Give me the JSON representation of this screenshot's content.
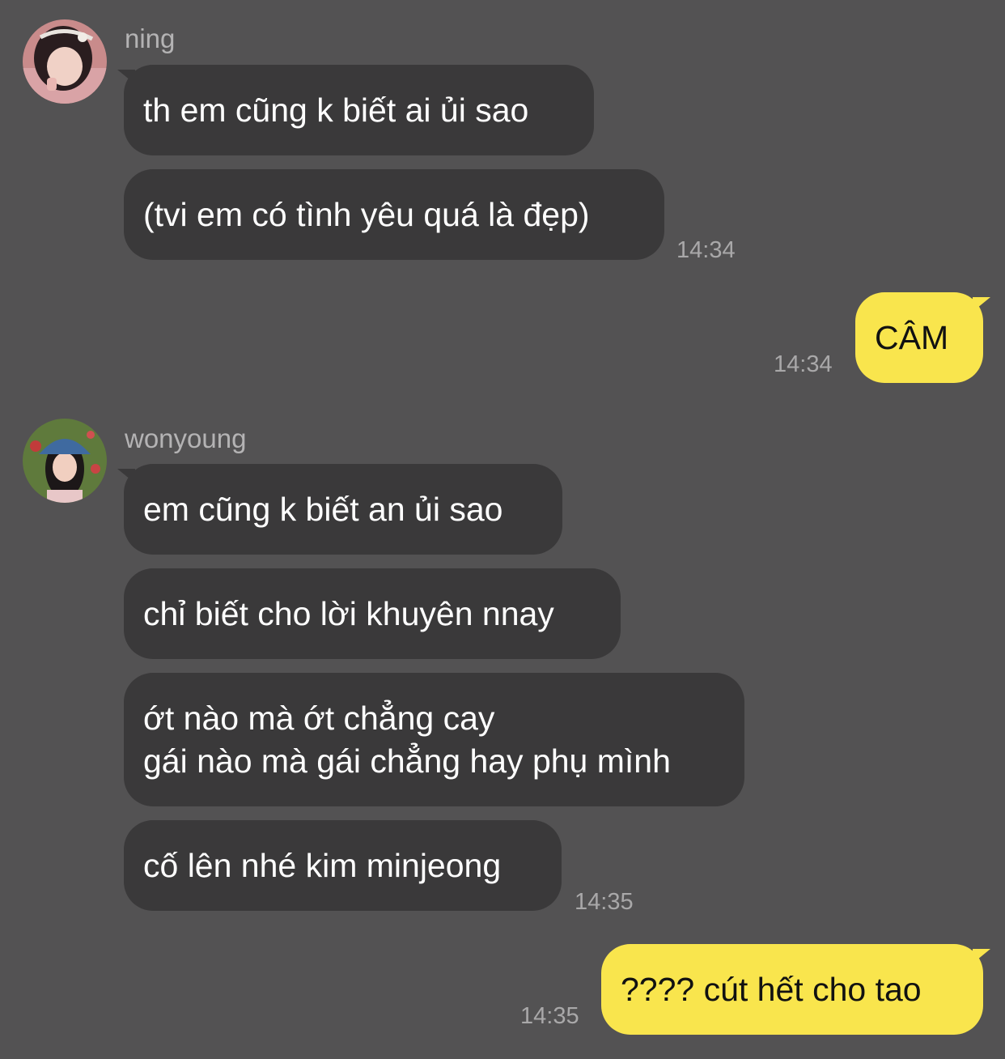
{
  "colors": {
    "background": "#535253",
    "incoming_bubble": "#3a393a",
    "outgoing_bubble": "#f9e54d",
    "sender_name": "#b4b3b4",
    "timestamp": "#a9a8a9"
  },
  "groups": [
    {
      "sender": "ning",
      "avatar_icon": "profile-photo-icon",
      "messages": [
        "th em cũng k biết ai ủi sao",
        "(tvi em có tình yêu quá là đẹp)"
      ],
      "time": "14:34"
    },
    {
      "outgoing": true,
      "messages": [
        "CÂM"
      ],
      "time": "14:34"
    },
    {
      "sender": "wonyoung",
      "avatar_icon": "profile-photo-icon",
      "messages": [
        "em cũng k biết an ủi sao",
        "chỉ biết cho lời khuyên nnay",
        "ớt nào mà ớt chẳng cay\ngái nào mà gái chẳng hay phụ mình",
        "cố lên nhé kim minjeong"
      ],
      "time": "14:35"
    },
    {
      "outgoing": true,
      "messages": [
        "???? cút hết cho tao"
      ],
      "time": "14:35"
    }
  ]
}
